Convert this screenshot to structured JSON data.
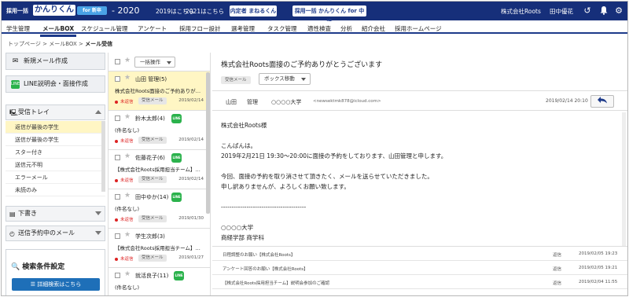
{
  "header": {
    "brand_small": "採用一括",
    "logo_text": "かんりくん",
    "logo_badge": "for 新卒",
    "year_label": "- 2020",
    "mode1": "2019はこちら",
    "mode2": "2021はこちら",
    "product1": "内定者 まねるくん",
    "product2": "採用一括 かんりくん for 中途",
    "company": "株式会社Roots",
    "user": "田中優花",
    "icons": [
      "help-icon",
      "bell-icon",
      "gear-icon"
    ]
  },
  "nav": {
    "items": [
      "学生管理",
      "メールBOX",
      "スケジュール管理",
      "アンケート",
      "採用フロー設計",
      "選考管理",
      "タスク管理",
      "適性検査",
      "分析",
      "紹介会社",
      "採用ホームページ"
    ],
    "active": "メールBOX"
  },
  "breadcrumb": {
    "home": "トップページ",
    "sep1": ">",
    "box": "メールBOX",
    "sep2": ">",
    "current": "メール受信"
  },
  "sidebar": {
    "new_mail": "新規メール作成",
    "line_btn": "LINE説明会・面接作成",
    "inbox_title": "受信トレイ",
    "inbox_items": [
      "返信が最後の学生",
      "送信が最後の学生",
      "スター付き",
      "送信元不明",
      "エラーメール",
      "未読のみ"
    ],
    "drafts": "下書き",
    "scheduled": "送信予約中のメール",
    "search_title": "検索条件設定",
    "detail_search": "詳細検索はこちら"
  },
  "mail_list": {
    "bulk_action": "一括操作",
    "unread_label": "未返信",
    "tag_label": "受信メール",
    "line_label": "LINE",
    "mails": [
      {
        "name": "山田 管理(5)",
        "subject": "株式会社Roots面接のご予約ありが…",
        "date": "2019/02/14",
        "line": false,
        "selected": true
      },
      {
        "name": "鈴木太郎(4)",
        "subject": "(件名なし)",
        "date": "2019/02/14",
        "line": true,
        "selected": false
      },
      {
        "name": "佐藤花子(6)",
        "subject": "【株式会社Roots採用担当チーム】…",
        "date": "2019/02/14",
        "line": true,
        "selected": false
      },
      {
        "name": "田中ゆか(14)",
        "subject": "(件名なし)",
        "date": "2019/01/30",
        "line": true,
        "selected": false
      },
      {
        "name": "学生次郎(3)",
        "subject": "【株式会社Roots採用担当チーム】…",
        "date": "2019/01/27",
        "line": false,
        "selected": false
      },
      {
        "name": "就活良子(11)",
        "subject": "(件名なし)",
        "date": "",
        "line": true,
        "selected": false
      }
    ]
  },
  "detail": {
    "subject": "株式会社Roots面接のご予約ありがとうございます",
    "tag": "受信メール",
    "move_box": "ボックス移動",
    "sender_last": "山田",
    "sender_first": "管理",
    "university": "○○○○大学",
    "email": "<newsektmk878@icloud.com>",
    "date": "2019/02/14 20:10",
    "body_lines": [
      "株式会社Roots様",
      "",
      "こんばんは。",
      "2019年2月21日 19:30〜20:00に面接の予約をしております、山田管理と申します。",
      "",
      "今回、面接の予約を取り消させて頂きたく、メールを送らせていただきました。",
      "申し訳ありませんが、よろしくお願い致します。",
      "",
      "----------------------------------------",
      "",
      "○○○○大学",
      "商経学部 商学科"
    ],
    "thread": [
      {
        "subject": "日程調整のお願い【株式会社Roots】",
        "kind": "返信",
        "date": "2019/02/05 19:23"
      },
      {
        "subject": "アンケート回答のお願い【株式会社Roots】",
        "kind": "返信",
        "date": "2019/02/05 19:21"
      },
      {
        "subject": "【株式会社Roots採用担当チーム】説明会参加のご確認",
        "kind": "返信",
        "date": "2019/02/04 11:55"
      }
    ]
  }
}
